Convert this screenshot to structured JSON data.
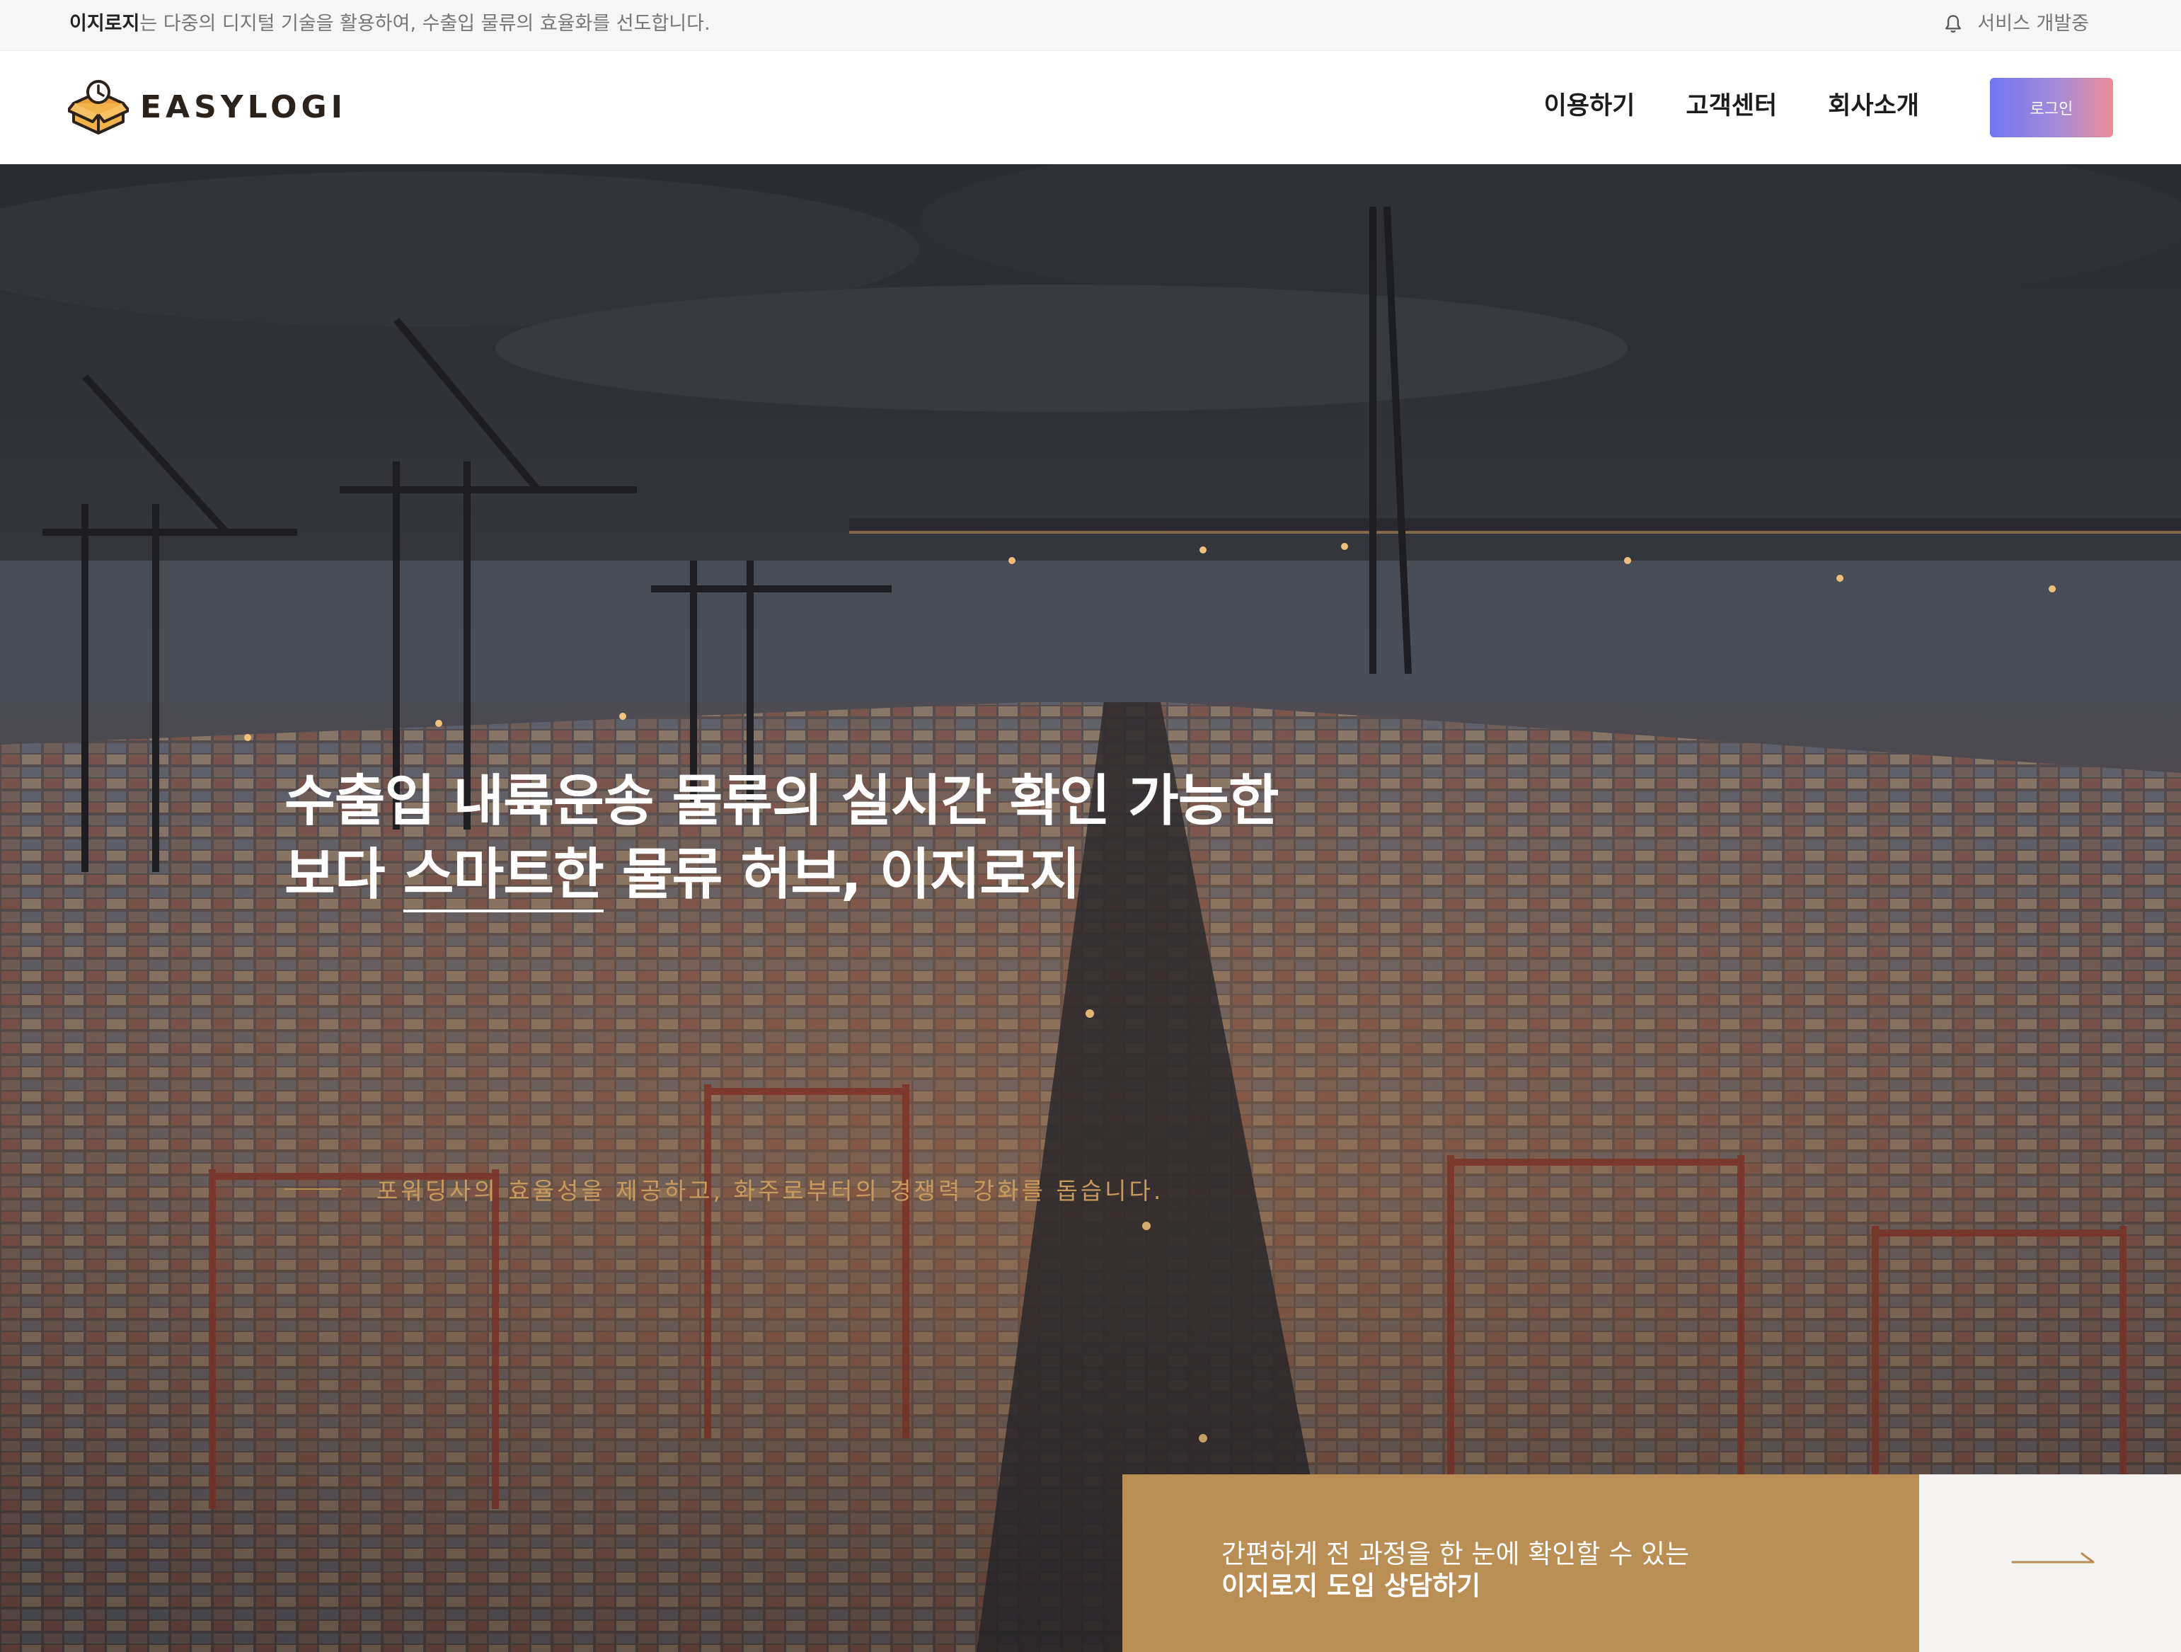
{
  "topbar": {
    "brand": "이지로지",
    "message": "는 다중의 디지털 기술을 활용하여, 수출입 물류의 효율화를 선도합니다.",
    "status": "서비스 개발중",
    "status_icon": "bell-icon"
  },
  "header": {
    "logo_text": "EASYLOGI",
    "logo_icon": "box-clock-icon",
    "nav": [
      {
        "label": "이용하기"
      },
      {
        "label": "고객센터"
      },
      {
        "label": "회사소개"
      }
    ],
    "login_label": "로그인"
  },
  "hero": {
    "title_line1": "수출입 내륙운송 물류의 실시간 확인 가능한",
    "title_line2_prefix": "보다 ",
    "title_line2_underlined": "스마트한",
    "title_line2_middle": " 물류 허브, ",
    "title_line2_bold": "이지로지",
    "subtitle": "포워딩사의 효율성을 제공하고, 화주로부터의 경쟁력 강화를 돕습니다.",
    "background": "night container port aerial"
  },
  "cta": {
    "line1": "간편하게 전 과정을 한 눈에 확인할 수 있는",
    "line2": "이지로지 도입 상담하기",
    "arrow_icon": "long-arrow-right-icon"
  },
  "colors": {
    "accent_gold": "#b98f55",
    "subtitle_gold": "#c79a5e",
    "login_gradient_start": "#6f76f2",
    "login_gradient_end": "#ec8c97"
  }
}
